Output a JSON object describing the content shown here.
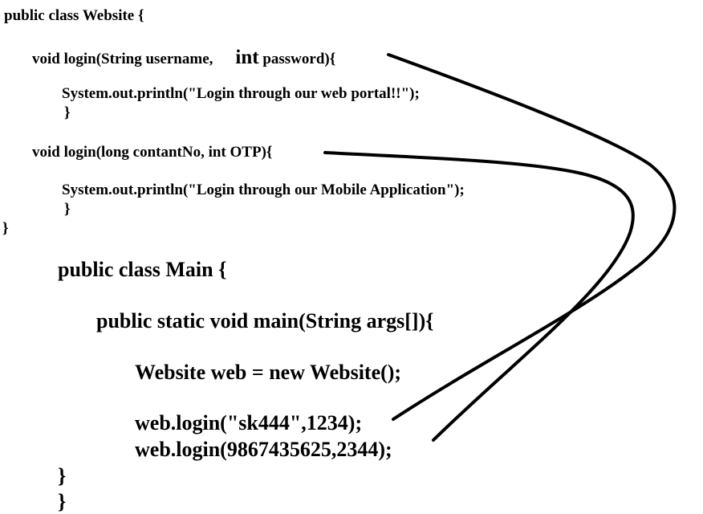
{
  "website_class": {
    "header": "public class Website {",
    "method1": {
      "signature_prefix": "void login(String username,",
      "param_type": "int",
      "signature_suffix": "password){",
      "body": "System.out.println(\"Login through our web portal!!\");",
      "close": "}"
    },
    "method2": {
      "signature": "void login(long contantNo, int OTP){",
      "body": "System.out.println(\"Login through our Mobile Application\");",
      "close": "}"
    },
    "close": "}"
  },
  "main_class": {
    "header": "public class Main {",
    "main_method": "public static void main(String args[]){",
    "instantiation": "Website web = new Website();",
    "call1": "web.login(\"sk444\",1234);",
    "call2": "web.login(9867435625,2344);",
    "close_method": "}",
    "close_class": "}"
  },
  "connectors": [
    {
      "from": "method1",
      "to": "call1",
      "color": "#000000"
    },
    {
      "from": "method2",
      "to": "call2",
      "color": "#000000"
    }
  ]
}
